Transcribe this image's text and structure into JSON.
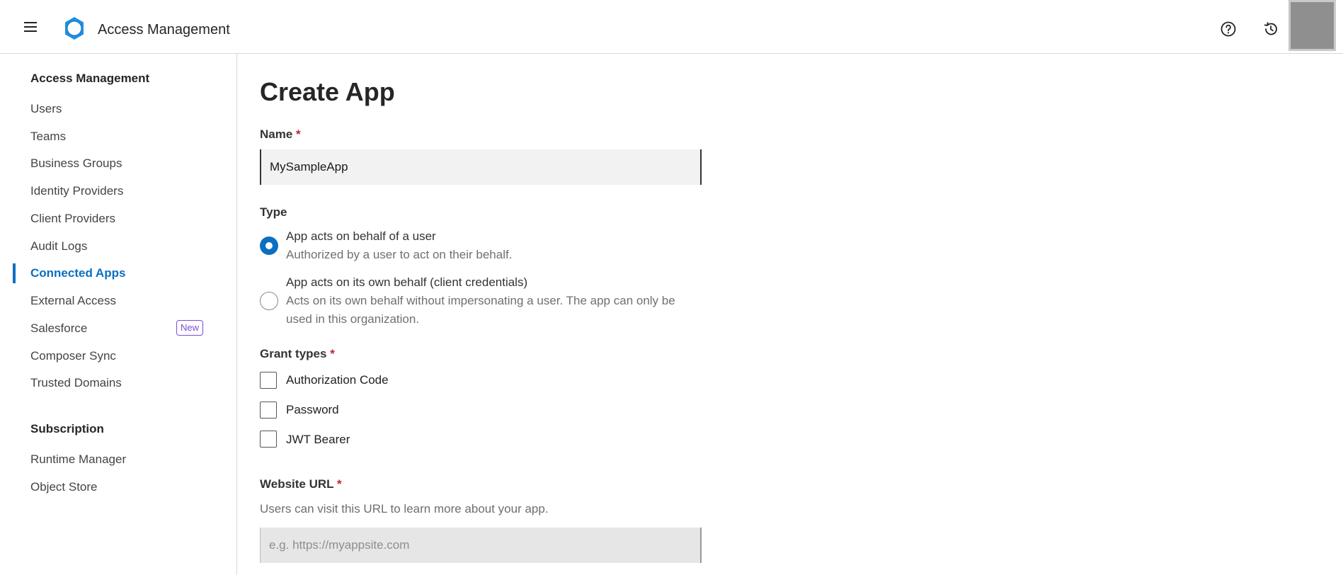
{
  "header": {
    "title": "Access Management",
    "icons": [
      "menu-icon",
      "gear-logo-icon",
      "help-circle-icon",
      "history-icon"
    ],
    "accent_color": "#0a6fc2"
  },
  "sidebar": {
    "section1_heading": "Access Management",
    "items": [
      {
        "label": "Users"
      },
      {
        "label": "Teams"
      },
      {
        "label": "Business Groups"
      },
      {
        "label": "Identity Providers"
      },
      {
        "label": "Client Providers"
      },
      {
        "label": "Audit Logs"
      },
      {
        "label": "Connected Apps",
        "active": true
      },
      {
        "label": "External Access"
      },
      {
        "label": "Salesforce",
        "badge": "New"
      },
      {
        "label": "Composer Sync"
      },
      {
        "label": "Trusted Domains"
      }
    ],
    "section2_heading": "Subscription",
    "items2": [
      {
        "label": "Runtime Manager"
      },
      {
        "label": "Object Store"
      }
    ]
  },
  "form": {
    "title": "Create App",
    "name_label": "Name",
    "required_mark": "*",
    "name_value": "MySampleApp",
    "type_label": "Type",
    "type_options": [
      {
        "title": "App acts on behalf of a user",
        "description": "Authorized by a user to act on their behalf.",
        "selected": true
      },
      {
        "title": "App acts on its own behalf (client credentials)",
        "description": "Acts on its own behalf without impersonating a user. The app can only be used in this organization.",
        "selected": false
      }
    ],
    "grant_types_label": "Grant types",
    "grant_types": [
      {
        "label": "Authorization Code",
        "checked": false
      },
      {
        "label": "Password",
        "checked": false
      },
      {
        "label": "JWT Bearer",
        "checked": false
      }
    ],
    "website_label": "Website URL",
    "website_help": "Users can visit this URL to learn more about your app.",
    "website_placeholder": "e.g. https://myappsite.com"
  }
}
